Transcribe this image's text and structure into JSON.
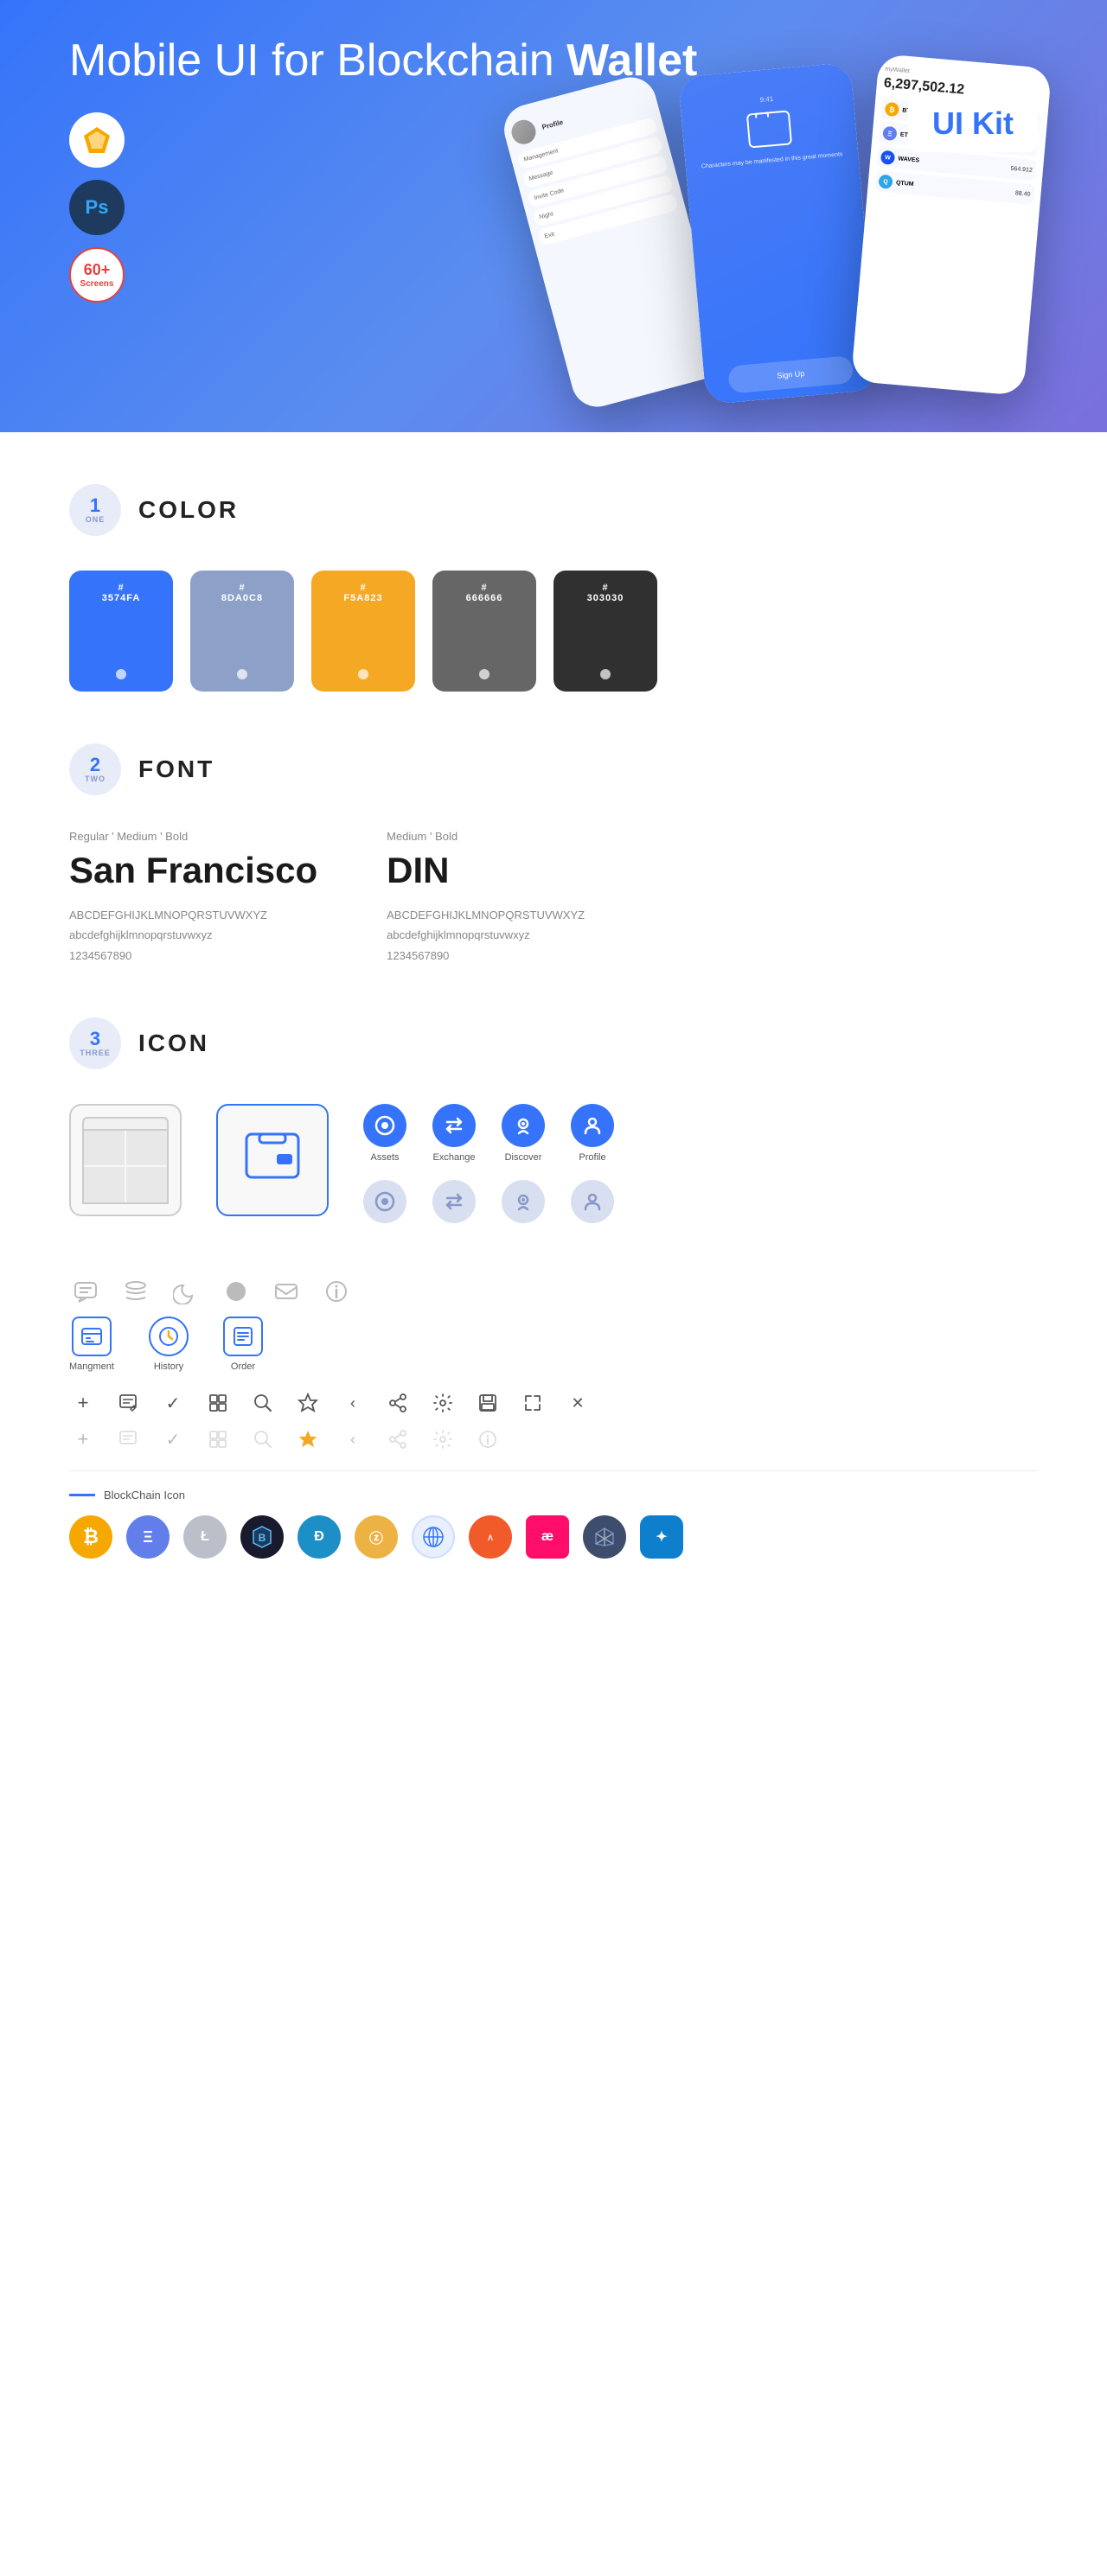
{
  "hero": {
    "title_normal": "Mobile UI for Blockchain ",
    "title_bold": "Wallet",
    "ui_kit_badge": "UI Kit",
    "badge_ps": "Ps",
    "badge_screens_num": "60+",
    "badge_screens_label": "Screens"
  },
  "sections": {
    "color": {
      "num": "1",
      "word": "ONE",
      "title": "COLOR",
      "swatches": [
        {
          "hex": "#3574FA",
          "label": "3574FA"
        },
        {
          "hex": "#8DA0C8",
          "label": "8DA0C8"
        },
        {
          "hex": "#F5A823",
          "label": "F5A823"
        },
        {
          "hex": "#666666",
          "label": "666666"
        },
        {
          "hex": "#303030",
          "label": "303030"
        }
      ]
    },
    "font": {
      "num": "2",
      "word": "TWO",
      "title": "FONT",
      "fonts": [
        {
          "style": "Regular ' Medium ' Bold",
          "name": "San Francisco",
          "uppercase": "ABCDEFGHIJKLMNOPQRSTUVWXYZ",
          "lowercase": "abcdefghijklmnopqrstuvwxyz",
          "numbers": "1234567890"
        },
        {
          "style": "Medium ' Bold",
          "name": "DIN",
          "uppercase": "ABCDEFGHIJKLMNOPQRSTUVWXYZ",
          "lowercase": "abcdefghijklmnopqrstuvwxyz",
          "numbers": "1234567890"
        }
      ]
    },
    "icon": {
      "num": "3",
      "word": "THREE",
      "title": "ICON",
      "nav_icons": [
        {
          "label": "Assets"
        },
        {
          "label": "Exchange"
        },
        {
          "label": "Discover"
        },
        {
          "label": "Profile"
        }
      ],
      "mgmt_icons": [
        {
          "label": "Mangment"
        },
        {
          "label": "History"
        },
        {
          "label": "Order"
        }
      ],
      "blockchain_label": "BlockChain Icon"
    }
  }
}
